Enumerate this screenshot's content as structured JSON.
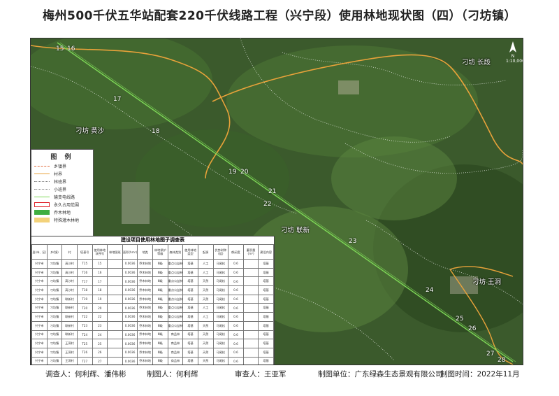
{
  "title": "梅州500千伏五华站配套220千伏线路工程（兴宁段）使用林地现状图（四）（刁坊镇）",
  "map": {
    "north_label": "N",
    "scale_text": "1:10,000",
    "tower_numbers": [
      "15",
      "16",
      "17",
      "18",
      "19",
      "20",
      "21",
      "22",
      "23",
      "24",
      "25",
      "26",
      "27",
      "28"
    ],
    "places": [
      "刁坊 长段",
      "刁坊 黄沙",
      "刁坊 联新",
      "刁坊 王洞"
    ]
  },
  "legend": {
    "title": "图 例",
    "items": [
      {
        "label": "乡镇界",
        "color": "#e06a3a",
        "style": "dash"
      },
      {
        "label": "村界",
        "color": "#e8a23a",
        "style": "line"
      },
      {
        "label": "林班界",
        "color": "#c9c9c9",
        "style": "dot"
      },
      {
        "label": "小班界",
        "color": "#bbbbbb",
        "style": "dot"
      },
      {
        "label": "输变电线路",
        "color": "#7ed957",
        "style": "line"
      },
      {
        "label": "永久占用范围",
        "color": "#e0222a",
        "style": "box"
      },
      {
        "label": "乔木林地",
        "color": "#3fae3f",
        "style": "fill"
      },
      {
        "label": "特殊灌木林地",
        "color": "#f3d27a",
        "style": "fill"
      }
    ]
  },
  "table": {
    "title": "建设项目使用林地图子调查表",
    "headers": [
      "县(市、区)",
      "乡(镇)",
      "村",
      "塔基号",
      "使用林地块序号",
      "林地图斑",
      "面积(hm²)",
      "地类",
      "林地保护等级",
      "森林类别",
      "使用林地类型",
      "起源",
      "优势树种(组)",
      "郁闭度",
      "蓄积量(m³)",
      "建设内容"
    ],
    "rows": [
      [
        "兴宁市",
        "刁坊镇",
        "高沙村",
        "T15",
        "15",
        "",
        "0.0036",
        "乔木林地",
        "Ⅲ级",
        "重点公益林",
        "塔基",
        "人工",
        "马尾松",
        "0.6",
        "",
        "塔基"
      ],
      [
        "兴宁市",
        "刁坊镇",
        "高沙村",
        "T16",
        "16",
        "",
        "0.0036",
        "乔木林地",
        "Ⅲ级",
        "重点公益林",
        "塔基",
        "人工",
        "马尾松",
        "0.6",
        "",
        "塔基"
      ],
      [
        "兴宁市",
        "刁坊镇",
        "高沙村",
        "T17",
        "17",
        "",
        "0.0036",
        "乔木林地",
        "Ⅲ级",
        "重点公益林",
        "塔基",
        "天然",
        "马尾松",
        "0.6",
        "",
        "塔基"
      ],
      [
        "兴宁市",
        "刁坊镇",
        "高沙村",
        "T18",
        "18",
        "",
        "0.0036",
        "乔木林地",
        "Ⅲ级",
        "重点公益林",
        "塔基",
        "天然",
        "马尾松",
        "0.6",
        "",
        "塔基"
      ],
      [
        "兴宁市",
        "刁坊镇",
        "联新村",
        "T19",
        "19",
        "",
        "0.0036",
        "乔木林地",
        "Ⅲ级",
        "重点公益林",
        "塔基",
        "天然",
        "马尾松",
        "0.6",
        "",
        "塔基"
      ],
      [
        "兴宁市",
        "刁坊镇",
        "联新村",
        "T20",
        "20",
        "",
        "0.0036",
        "乔木林地",
        "Ⅲ级",
        "重点公益林",
        "塔基",
        "人工",
        "马尾松",
        "0.6",
        "",
        "塔基"
      ],
      [
        "兴宁市",
        "刁坊镇",
        "联新村",
        "T22",
        "22",
        "",
        "0.0036",
        "乔木林地",
        "Ⅲ级",
        "重点公益林",
        "塔基",
        "人工",
        "马尾松",
        "0.6",
        "",
        "塔基"
      ],
      [
        "兴宁市",
        "刁坊镇",
        "联新村",
        "T23",
        "23",
        "",
        "0.0036",
        "乔木林地",
        "Ⅲ级",
        "重点公益林",
        "塔基",
        "天然",
        "马尾松",
        "0.6",
        "",
        "塔基"
      ],
      [
        "兴宁市",
        "刁坊镇",
        "联新村",
        "T24",
        "24",
        "",
        "0.0036",
        "乔木林地",
        "Ⅲ级",
        "商品林",
        "塔基",
        "天然",
        "马尾松",
        "0.6",
        "",
        "塔基"
      ],
      [
        "兴宁市",
        "刁坊镇",
        "王洞村",
        "T25",
        "25",
        "",
        "0.0036",
        "乔木林地",
        "Ⅲ级",
        "商品林",
        "塔基",
        "天然",
        "马尾松",
        "0.6",
        "",
        "塔基"
      ],
      [
        "兴宁市",
        "刁坊镇",
        "王洞村",
        "T26",
        "26",
        "",
        "0.0036",
        "乔木林地",
        "Ⅲ级",
        "商品林",
        "塔基",
        "天然",
        "马尾松",
        "0.6",
        "",
        "塔基"
      ],
      [
        "兴宁市",
        "刁坊镇",
        "王洞村",
        "T27",
        "27",
        "",
        "0.0036",
        "乔木林地",
        "Ⅲ级",
        "商品林",
        "塔基",
        "天然",
        "马尾松",
        "0.6",
        "",
        "塔基"
      ]
    ]
  },
  "footer": {
    "surveyors": "调查人：何利辉、潘伟彬",
    "drafter": "制图人：何利辉",
    "reviewer": "审查人：王亚军",
    "org": "制图单位：广东绿森生态景观有限公司",
    "date": "制图时间：2022年11月"
  }
}
